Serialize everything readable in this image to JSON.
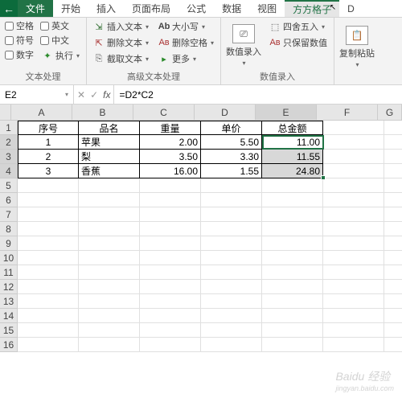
{
  "tabs": {
    "file": "文件",
    "t1": "开始",
    "t2": "插入",
    "t3": "页面布局",
    "t4": "公式",
    "t5": "数据",
    "t6": "视图",
    "t7": "方方格子",
    "t8": "D"
  },
  "ribbon": {
    "group1": {
      "label": "文本处理",
      "chks": {
        "c1": "空格",
        "c2": "英文",
        "c3": "符号",
        "c4": "中文",
        "c5": "数字",
        "c6": "执行"
      }
    },
    "group2": {
      "label": "高级文本处理",
      "col1": {
        "b1": "插入文本",
        "b2": "删除文本",
        "b3": "截取文本"
      },
      "col2": {
        "b1": "大小写",
        "b2": "删除空格",
        "b3": "更多"
      }
    },
    "group3": {
      "label": "数值录入",
      "big": "数值录入",
      "b1": "四舍五入",
      "b2": "只保留数值"
    },
    "group4": {
      "big": "复制粘贴"
    }
  },
  "namebox": "E2",
  "formula": "=D2*C2",
  "cols": [
    "A",
    "B",
    "C",
    "D",
    "E",
    "F",
    "G"
  ],
  "table": {
    "h": {
      "a": "序号",
      "b": "品名",
      "c": "重量",
      "d": "单价",
      "e": "总金额"
    },
    "r1": {
      "a": "1",
      "b": "苹果",
      "c": "2.00",
      "d": "5.50",
      "e": "11.00"
    },
    "r2": {
      "a": "2",
      "b": "梨",
      "c": "3.50",
      "d": "3.30",
      "e": "11.55"
    },
    "r3": {
      "a": "3",
      "b": "香蕉",
      "c": "16.00",
      "d": "1.55",
      "e": "24.80"
    }
  },
  "watermark": {
    "main": "Baidu 经验",
    "sub": "jingyan.baidu.com"
  }
}
